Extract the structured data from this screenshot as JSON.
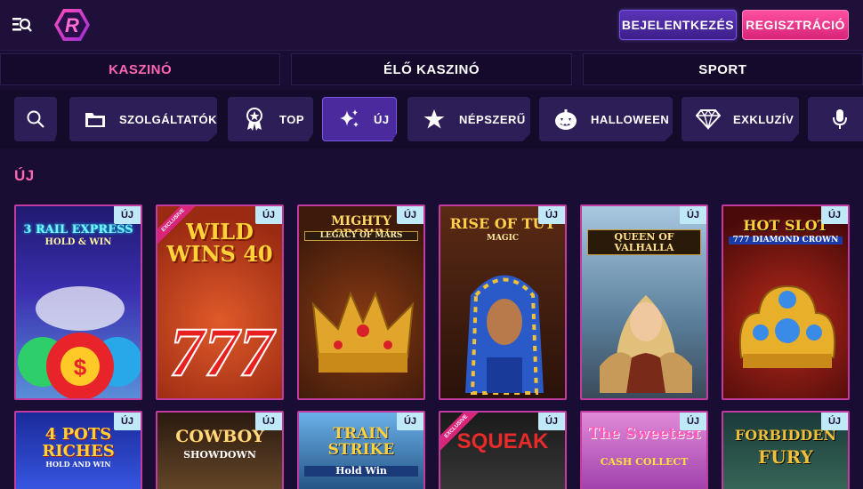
{
  "header": {
    "login_label": "BEJELENTKEZÉS",
    "register_label": "REGISZTRÁCIÓ",
    "logo_letter": "R"
  },
  "main_tabs": [
    {
      "label": "KASZINÓ",
      "active": true
    },
    {
      "label": "ÉLŐ KASZINÓ",
      "active": false
    },
    {
      "label": "SPORT",
      "active": false
    }
  ],
  "categories": [
    {
      "label": "",
      "icon": "search-icon"
    },
    {
      "label": "SZOLGÁLTATÓK",
      "icon": "folder-icon"
    },
    {
      "label": "TOP",
      "icon": "medal-icon"
    },
    {
      "label": "ÚJ",
      "icon": "sparkle-icon",
      "active": true
    },
    {
      "label": "NÉPSZERŰ",
      "icon": "star-icon"
    },
    {
      "label": "HALLOWEEN",
      "icon": "pumpkin-icon"
    },
    {
      "label": "EXKLUZÍV",
      "icon": "diamond-icon"
    },
    {
      "label": "",
      "icon": "microphone-icon"
    }
  ],
  "section_title": "ÚJ",
  "badge_label": "ÚJ",
  "exclusive_label": "EXCLUSIVE",
  "games_row1": [
    {
      "title": "3 RAIL EXPRESS",
      "subtitle": "HOLD & WIN",
      "bg": "#2b1f8a"
    },
    {
      "title": "WILD WINS 40",
      "subtitle": "",
      "bg": "#b8381d"
    },
    {
      "title": "MIGHTY CROWN",
      "subtitle": "LEGACY OF MARS",
      "bg": "#6b2a12"
    },
    {
      "title": "RISE OF TUT",
      "subtitle": "MAGIC",
      "bg": "#3a1a10"
    },
    {
      "title": "QUEEN OF VALHALLA",
      "subtitle": "",
      "bg": "#5a7e9a"
    },
    {
      "title": "HOT SLOT",
      "subtitle": "777 DIAMOND CROWN",
      "bg": "#6a1414"
    }
  ],
  "games_row2": [
    {
      "title": "4 POTS RICHES",
      "subtitle": "HOLD AND WIN",
      "bg": "#2c3fa8"
    },
    {
      "title": "COWBOY",
      "subtitle": "SHOWDOWN",
      "bg": "#5a3a1c"
    },
    {
      "title": "TRAIN STRIKE",
      "subtitle": "Hold Win",
      "bg": "#1d4a7a"
    },
    {
      "title": "SQUEAK",
      "subtitle": "",
      "bg": "#222"
    },
    {
      "title": "The Sweetest",
      "subtitle": "CASH COLLECT",
      "bg": "#b255b8"
    },
    {
      "title": "FORBIDDEN",
      "subtitle": "FURY",
      "bg": "#2b4a4a"
    }
  ],
  "colors": {
    "accent_pink": "#ff66b2",
    "badge": "#bfe9f7",
    "card_border": "#c23ca0"
  }
}
